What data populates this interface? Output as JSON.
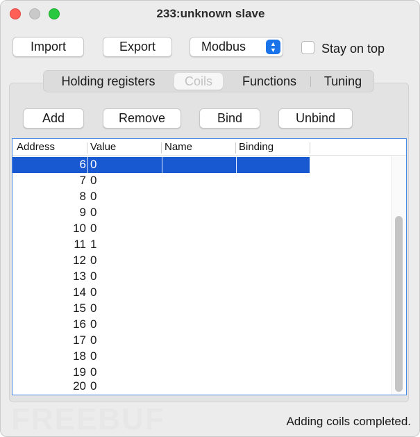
{
  "window": {
    "title": "233:unknown slave"
  },
  "toolbar": {
    "import_label": "Import",
    "export_label": "Export",
    "protocol_value": "Modbus",
    "stay_on_top_label": "Stay on top",
    "stay_on_top_checked": false
  },
  "tabs": [
    {
      "label": "Holding registers",
      "active": false
    },
    {
      "label": "Coils",
      "active": true
    },
    {
      "label": "Functions",
      "active": false
    },
    {
      "label": "Tuning",
      "active": false
    }
  ],
  "actions": {
    "add_label": "Add",
    "remove_label": "Remove",
    "bind_label": "Bind",
    "unbind_label": "Unbind"
  },
  "table": {
    "columns": [
      "Address",
      "Value",
      "Name",
      "Binding"
    ],
    "rows": [
      {
        "address": "6",
        "value": "0",
        "name": "",
        "binding": "",
        "selected": true
      },
      {
        "address": "7",
        "value": "0"
      },
      {
        "address": "8",
        "value": "0"
      },
      {
        "address": "9",
        "value": "0"
      },
      {
        "address": "10",
        "value": "0"
      },
      {
        "address": "11",
        "value": "1"
      },
      {
        "address": "12",
        "value": "0"
      },
      {
        "address": "13",
        "value": "0"
      },
      {
        "address": "14",
        "value": "0"
      },
      {
        "address": "15",
        "value": "0"
      },
      {
        "address": "16",
        "value": "0"
      },
      {
        "address": "17",
        "value": "0"
      },
      {
        "address": "18",
        "value": "0"
      },
      {
        "address": "19",
        "value": "0"
      },
      {
        "address": "20",
        "value": "0"
      }
    ]
  },
  "status": {
    "text": "Adding coils completed."
  },
  "watermark": {
    "text": "FREEBUF"
  },
  "colors": {
    "selection": "#1858d0",
    "select_arrow": "#1a73e8",
    "close": "#fe5f57",
    "maximize": "#28c840"
  }
}
